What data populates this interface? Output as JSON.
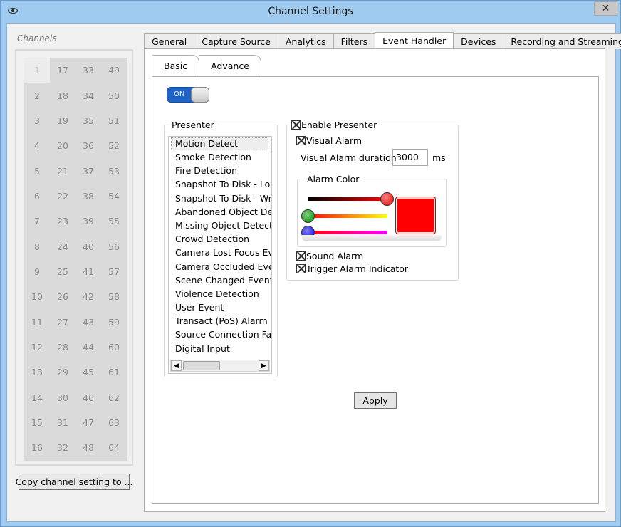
{
  "window": {
    "title": "Channel Settings",
    "close_glyph": "✕",
    "app_icon": "eye-icon"
  },
  "channels": {
    "legend": "Channels",
    "selected": "1",
    "cells": [
      "1",
      "17",
      "33",
      "49",
      "2",
      "18",
      "34",
      "50",
      "3",
      "19",
      "35",
      "51",
      "4",
      "20",
      "36",
      "52",
      "5",
      "21",
      "37",
      "53",
      "6",
      "22",
      "38",
      "54",
      "7",
      "23",
      "39",
      "55",
      "8",
      "24",
      "40",
      "56",
      "9",
      "25",
      "41",
      "57",
      "10",
      "26",
      "42",
      "58",
      "11",
      "27",
      "43",
      "59",
      "12",
      "28",
      "44",
      "60",
      "13",
      "29",
      "45",
      "61",
      "14",
      "30",
      "46",
      "62",
      "15",
      "31",
      "47",
      "63",
      "16",
      "32",
      "48",
      "64"
    ],
    "copy_button": "Copy channel setting to ..."
  },
  "tabs": [
    "General",
    "Capture Source",
    "Analytics",
    "Filters",
    "Event Handler",
    "Devices",
    "Recording and Streaming"
  ],
  "active_tab": "Event Handler",
  "subtabs": [
    "Basic",
    "Advance"
  ],
  "active_subtab": "Basic",
  "toggle": {
    "label": "ON",
    "state": "on"
  },
  "presenter": {
    "label": "Presenter",
    "items": [
      "Motion Detect",
      "Smoke Detection",
      "Fire Detection",
      "Snapshot To Disk - Low",
      "Snapshot To Disk - Wri",
      "Abandoned Object Det",
      "Missing Object Detecti",
      "Crowd Detection",
      "Camera Lost Focus Eve",
      "Camera Occluded Even",
      "Scene Changed Event",
      "Violence Detection",
      "User Event",
      "Transact (PoS) Alarm",
      "Source Connection Fau",
      "Digital Input"
    ],
    "selected": "Motion Detect",
    "scroll_left": "◀",
    "scroll_right": "▶"
  },
  "enable": {
    "label": "Enable Presenter",
    "checked": true,
    "visual_alarm": {
      "label": "Visual Alarm",
      "checked": true
    },
    "duration": {
      "label": "Visual Alarm duration",
      "value": "3000",
      "unit": "ms"
    },
    "alarm_color": {
      "label": "Alarm Color",
      "swatch": "#ff0000",
      "red": 255,
      "green": 0,
      "blue": 0
    },
    "sound_alarm": {
      "label": "Sound Alarm",
      "checked": true
    },
    "trigger_indicator": {
      "label": "Trigger Alarm Indicator",
      "checked": true
    }
  },
  "apply_button": "Apply"
}
